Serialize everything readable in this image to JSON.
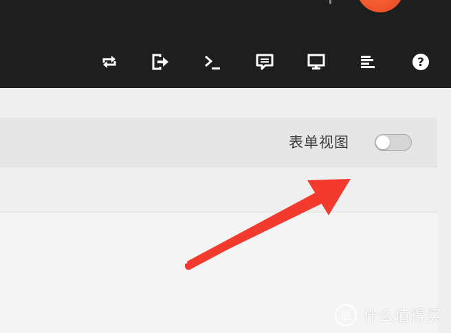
{
  "header": {
    "icons": [
      {
        "name": "sync-icon",
        "label": "sync"
      },
      {
        "name": "logout-icon",
        "label": "logout"
      },
      {
        "name": "terminal-icon",
        "label": "terminal"
      },
      {
        "name": "comment-icon",
        "label": "comment"
      },
      {
        "name": "monitor-icon",
        "label": "monitor"
      },
      {
        "name": "align-left-icon",
        "label": "align-left"
      },
      {
        "name": "help-icon",
        "label": "help"
      }
    ],
    "avatar_color": "#f25a2c",
    "background": "#1e1e1e"
  },
  "toolbar": {
    "form_view_label": "表单视图",
    "form_view_toggle": {
      "state": "off"
    }
  },
  "annotation": {
    "arrow_color": "#f23a2e"
  },
  "watermark": {
    "text": "什么值得买",
    "logo_glyph": "值"
  }
}
